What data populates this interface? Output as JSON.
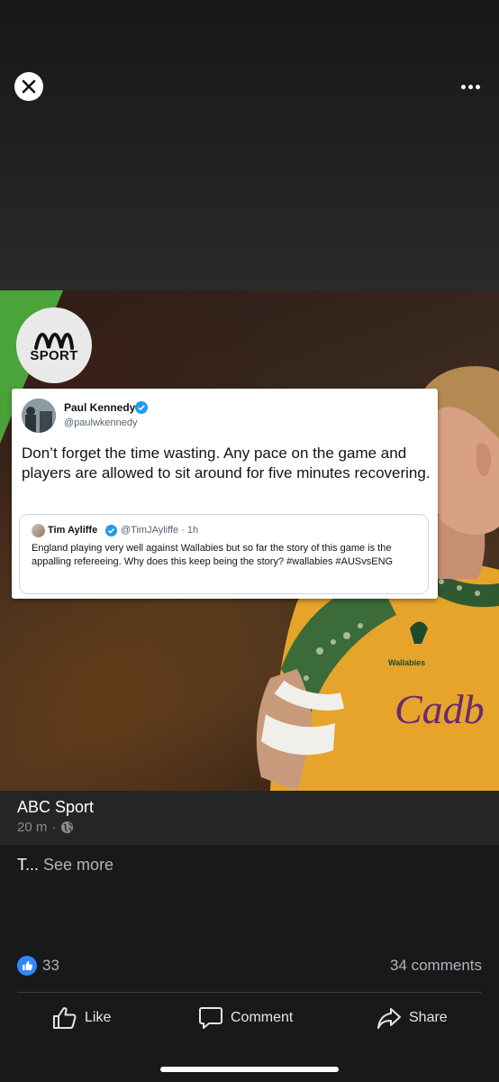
{
  "viewer": {
    "close_icon": "close-icon",
    "more_icon": "more-options-icon"
  },
  "image": {
    "brand_logo": "ABC Sport logo",
    "logo_text": "SPORT",
    "tweet": {
      "author_name": "Paul Kennedy",
      "author_handle": "@paulwkennedy",
      "text": "Don’t forget the time wasting. Any pace on the game and players are allowed to sit around for five minutes recovering.",
      "quoted": {
        "author_name": "Tim Ayliffe",
        "author_handle": "@TimJAyliffe · 1h",
        "text": "England playing very well against Wallabies but so far the story of this game is the appalling refereeing. Why does this keep being the story? #wallabies #AUSvsENG"
      }
    },
    "jersey_sponsor": "Cadb",
    "jersey_badge": "Wallabies"
  },
  "post": {
    "page_name": "ABC Sport",
    "time": "20 m",
    "privacy_sep": "·",
    "caption": "T...",
    "see_more": "See more"
  },
  "stats": {
    "reaction_count": "33",
    "comments": "34 comments"
  },
  "actions": {
    "like": "Like",
    "comment": "Comment",
    "share": "Share"
  },
  "colors": {
    "background": "#18191a",
    "info_bar": "#242526",
    "like_blue": "#2d88ff",
    "abc_green": "#4aa43a"
  }
}
